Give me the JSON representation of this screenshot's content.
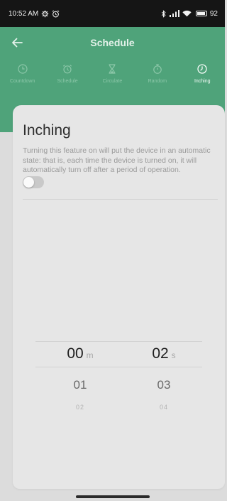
{
  "status_bar": {
    "time": "10:52 AM",
    "battery": "92",
    "icons": [
      "gear-icon",
      "alarm-icon",
      "bluetooth-icon",
      "signal-icon",
      "wifi-icon",
      "battery-icon"
    ]
  },
  "header": {
    "title": "Schedule",
    "back_icon": "arrow-left-icon",
    "bg_color": "#4fa37a"
  },
  "tabs": [
    {
      "label": "Countdown",
      "icon": "clock-icon",
      "active": false
    },
    {
      "label": "Schedule",
      "icon": "alarm-clock-icon",
      "active": false
    },
    {
      "label": "Circulate",
      "icon": "hourglass-icon",
      "active": false
    },
    {
      "label": "Random",
      "icon": "stopwatch-icon",
      "active": false
    },
    {
      "label": "Inching",
      "icon": "clock-check-icon",
      "active": true
    }
  ],
  "card": {
    "title": "Inching",
    "description": "Turning this feature on will put the device in an automatic state: that is, each time the device is turned on, it will automatically turn off after a period of operation.",
    "toggle_on": false
  },
  "picker": {
    "minutes": {
      "selected": "00",
      "unit": "m",
      "next": "01",
      "next2": "02"
    },
    "seconds": {
      "selected": "02",
      "unit": "s",
      "next": "03",
      "next2": "04"
    }
  }
}
